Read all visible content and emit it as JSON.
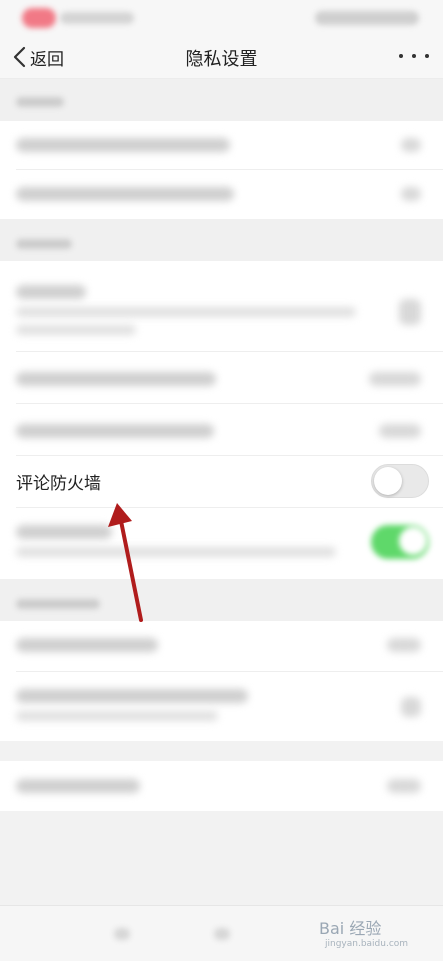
{
  "nav": {
    "back_label": "返回",
    "title": "隐私设置"
  },
  "firewall": {
    "label": "评论防火墙",
    "enabled": false
  },
  "annotation": {
    "arrow_color": "#b01c1c"
  },
  "watermark": {
    "brand": "Bai 经验",
    "url": "jingyan.baidu.com"
  },
  "colors": {
    "toggle_on": "#5fd86a",
    "background": "#f2f2f2"
  }
}
